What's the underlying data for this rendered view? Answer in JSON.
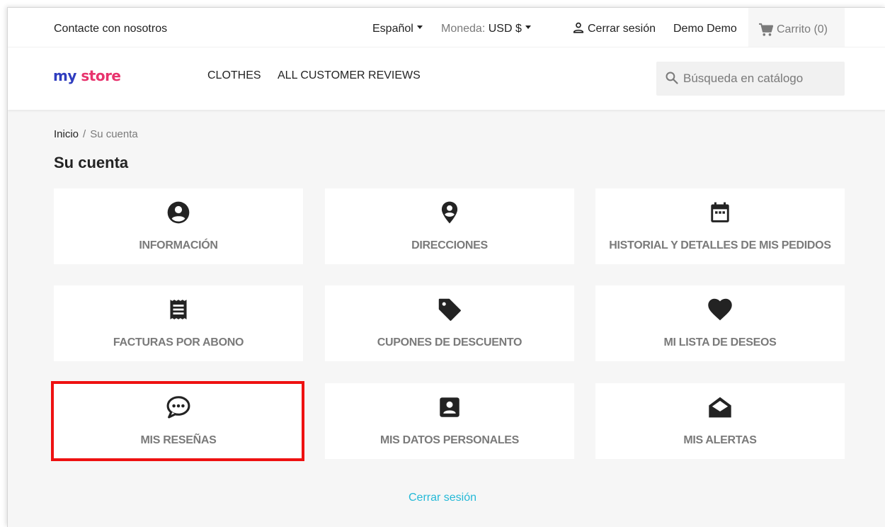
{
  "topnav": {
    "contact": "Contacte con nosotros",
    "language": "Español",
    "currency_label": "Moneda:",
    "currency_value": "USD $",
    "logout": "Cerrar sesión",
    "user_name": "Demo Demo",
    "cart": "Carrito (0)"
  },
  "logo": {
    "part1": "my",
    "part2": "store"
  },
  "menu": {
    "clothes": "CLOTHES",
    "reviews": "ALL CUSTOMER REVIEWS"
  },
  "search": {
    "placeholder": "Búsqueda en catálogo"
  },
  "breadcrumb": {
    "home": "Inicio",
    "separator": "/",
    "current": "Su cuenta"
  },
  "page": {
    "title": "Su cuenta"
  },
  "tiles": [
    {
      "label": "INFORMACIÓN",
      "icon": "account-circle-icon"
    },
    {
      "label": "DIRECCIONES",
      "icon": "location-pin-icon"
    },
    {
      "label": "HISTORIAL Y DETALLES DE MIS PEDIDOS",
      "icon": "calendar-icon"
    },
    {
      "label": "FACTURAS POR ABONO",
      "icon": "receipt-icon"
    },
    {
      "label": "CUPONES DE DESCUENTO",
      "icon": "tag-icon"
    },
    {
      "label": "MI LISTA DE DESEOS",
      "icon": "heart-icon"
    },
    {
      "label": "MIS RESEÑAS",
      "icon": "chat-bubble-icon"
    },
    {
      "label": "MIS DATOS PERSONALES",
      "icon": "contact-card-icon"
    },
    {
      "label": "MIS ALERTAS",
      "icon": "open-envelope-icon"
    }
  ],
  "footer": {
    "logout_link": "Cerrar sesión"
  },
  "colors": {
    "accent_link": "#24b9d7",
    "highlight": "#ee1111",
    "text_dark": "#232323",
    "text_gray": "#7a7a7a",
    "page_bg": "#f6f6f6"
  }
}
